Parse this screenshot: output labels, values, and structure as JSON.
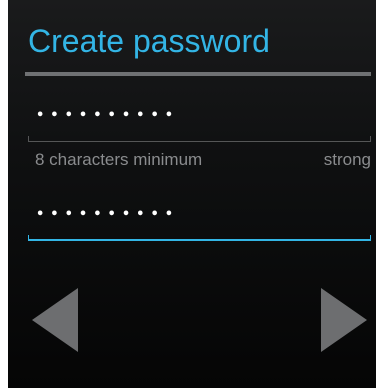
{
  "header": {
    "title": "Create password"
  },
  "password_field": {
    "masked_value": "••••••••••",
    "hint": "8 characters minimum",
    "strength": "strong"
  },
  "confirm_field": {
    "masked_value": "••••••••••"
  },
  "navigation": {
    "back_icon": "triangle-left-icon",
    "next_icon": "triangle-right-icon"
  },
  "colors": {
    "accent": "#33b5e5",
    "background": "#0f1011",
    "hint_text": "#8a8c8e",
    "nav_arrow": "#6d6e70"
  }
}
